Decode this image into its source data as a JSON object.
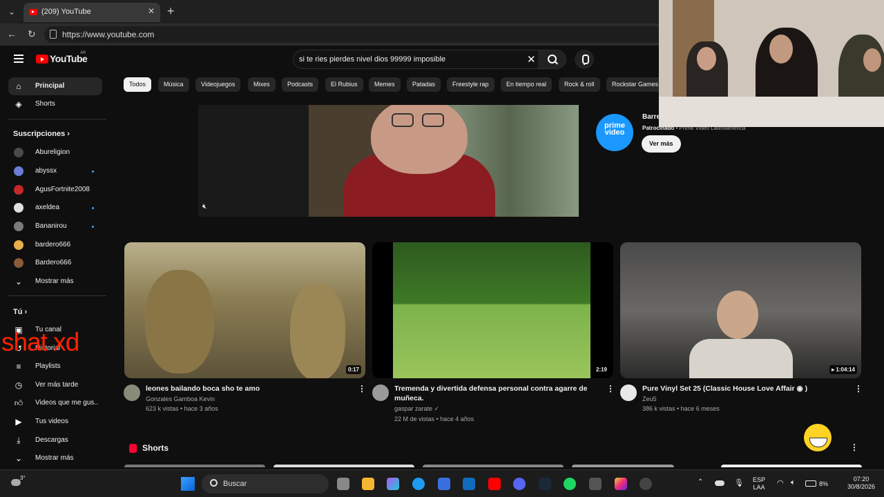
{
  "browser": {
    "tab_title": "(209) YouTube",
    "url": "https://www.youtube.com"
  },
  "youtube": {
    "logo_text": "YouTube",
    "logo_region": "AR",
    "search_query": "si te ries pierdes nivel dios 99999 imposible"
  },
  "sidebar": {
    "main": [
      {
        "label": "Principal",
        "icon": "home-icon"
      },
      {
        "label": "Shorts",
        "icon": "shorts-icon"
      }
    ],
    "subscriptions_title": "Suscripciones",
    "subscriptions": [
      {
        "label": "Abureligion",
        "color": "#4a4a4a",
        "new": false
      },
      {
        "label": "abyssx",
        "color": "#6b7bd6",
        "new": true
      },
      {
        "label": "AgusFortnite2008",
        "color": "#c62828",
        "new": false
      },
      {
        "label": "axeldea",
        "color": "#e0e0e0",
        "new": true
      },
      {
        "label": "Bananirou",
        "color": "#7a7a7a",
        "new": true
      },
      {
        "label": "bardero666",
        "color": "#e8b04a",
        "new": false
      },
      {
        "label": "Bardero666",
        "color": "#8a5a3a",
        "new": false
      },
      {
        "label": "Mostrar más",
        "color": "",
        "new": false
      }
    ],
    "you_title": "Tú",
    "you": [
      {
        "label": "Tu canal"
      },
      {
        "label": "Historial"
      },
      {
        "label": "Playlists"
      },
      {
        "label": "Ver más tarde"
      },
      {
        "label": "Videos que me gus..."
      },
      {
        "label": "Tus videos"
      },
      {
        "label": "Descargas"
      },
      {
        "label": "Mostrar más"
      }
    ]
  },
  "chips": [
    "Todos",
    "Música",
    "Videojuegos",
    "Mixes",
    "Podcasts",
    "El Rubius",
    "Memes",
    "Patadas",
    "Freestyle rap",
    "En tiempo real",
    "Rock & roll",
    "Rockstar Games"
  ],
  "ad": {
    "logo_line1": "prime",
    "logo_line2": "video",
    "title": "Barre",
    "sponsored": "Patrocinado",
    "advertiser": " • Prime Video Latinoamérica",
    "cta": "Ver más"
  },
  "videos": [
    {
      "title": "leones bailando boca sho te amo",
      "channel": "Gonzales Gamboa Kevin",
      "meta": "623 k vistas • hace 3 años",
      "duration": "0:17"
    },
    {
      "title": "Tremenda y divertida defensa personal contra agarre de muñeca.",
      "channel": "gaspar zarate ✓",
      "meta": "22 M de vistas • hace 4 años",
      "duration": "2:19"
    },
    {
      "title": "Pure Vinyl Set 25 (Classic House Love Affair ◉ )",
      "channel": "Zeu5",
      "meta": "386 k vistas • hace 6 meses",
      "duration": "▸ 1:04:14"
    }
  ],
  "shorts_title": "Shorts",
  "overlay": {
    "chat_text": "shat xd"
  },
  "taskbar": {
    "temp": "3°",
    "search_label": "Buscar",
    "lang1": "ESP",
    "lang2": "LAA",
    "battery": "8%",
    "time": "07:20",
    "date": "30/8/2026"
  }
}
